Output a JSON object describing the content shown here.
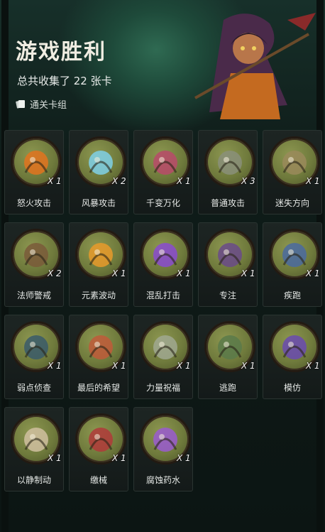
{
  "header": {
    "title": "游戏胜利",
    "subtitle": "总共收集了 22 张卡",
    "deck_label": "通关卡组",
    "deck_icon": "card-stack-icon"
  },
  "colors": {
    "accent_green": "#2f6a52",
    "card_bg": "#1d2523",
    "disc_base": "#6f7a3c",
    "disc_rim": "#231a12"
  },
  "cards": [
    {
      "name": "怒火攻击",
      "count": "X 1",
      "icon": "flame-fist-icon",
      "accent": "#e2731f"
    },
    {
      "name": "风暴攻击",
      "count": "X 2",
      "icon": "ice-storm-icon",
      "accent": "#7fd0e8"
    },
    {
      "name": "千变万化",
      "count": "X 1",
      "icon": "potion-plant-icon",
      "accent": "#b84a6a"
    },
    {
      "name": "普通攻击",
      "count": "X 3",
      "icon": "spear-strike-icon",
      "accent": "#8a8f7a"
    },
    {
      "name": "迷失方向",
      "count": "X 1",
      "icon": "signpost-icon",
      "accent": "#9a8a5a"
    },
    {
      "name": "法师警戒",
      "count": "X 2",
      "icon": "hooded-mage-icon",
      "accent": "#7a5a3a"
    },
    {
      "name": "元素波动",
      "count": "X 1",
      "icon": "element-wave-icon",
      "accent": "#e89a2a"
    },
    {
      "name": "混乱打击",
      "count": "X 1",
      "icon": "chaos-claw-icon",
      "accent": "#8a4ad0"
    },
    {
      "name": "专注",
      "count": "X 1",
      "icon": "wizard-focus-icon",
      "accent": "#6a4a8a"
    },
    {
      "name": "疾跑",
      "count": "X 1",
      "icon": "sprint-icon",
      "accent": "#4a6aa0"
    },
    {
      "name": "弱点侦查",
      "count": "X 1",
      "icon": "wolf-icon",
      "accent": "#3a5a6a"
    },
    {
      "name": "最后的希望",
      "count": "X 1",
      "icon": "girl-icon",
      "accent": "#c05a3a"
    },
    {
      "name": "力量祝福",
      "count": "X 1",
      "icon": "raised-fist-icon",
      "accent": "#a0a890"
    },
    {
      "name": "逃跑",
      "count": "X 1",
      "icon": "runner-icon",
      "accent": "#5a7a4a"
    },
    {
      "name": "模仿",
      "count": "X 1",
      "icon": "mask-icon",
      "accent": "#6a4ab0"
    },
    {
      "name": "以静制动",
      "count": "X 1",
      "icon": "skull-icon",
      "accent": "#d0c0a0"
    },
    {
      "name": "缴械",
      "count": "X 1",
      "icon": "axe-shield-icon",
      "accent": "#b03a3a"
    },
    {
      "name": "腐蚀药水",
      "count": "X 1",
      "icon": "poison-flask-icon",
      "accent": "#9a5ad0"
    }
  ]
}
